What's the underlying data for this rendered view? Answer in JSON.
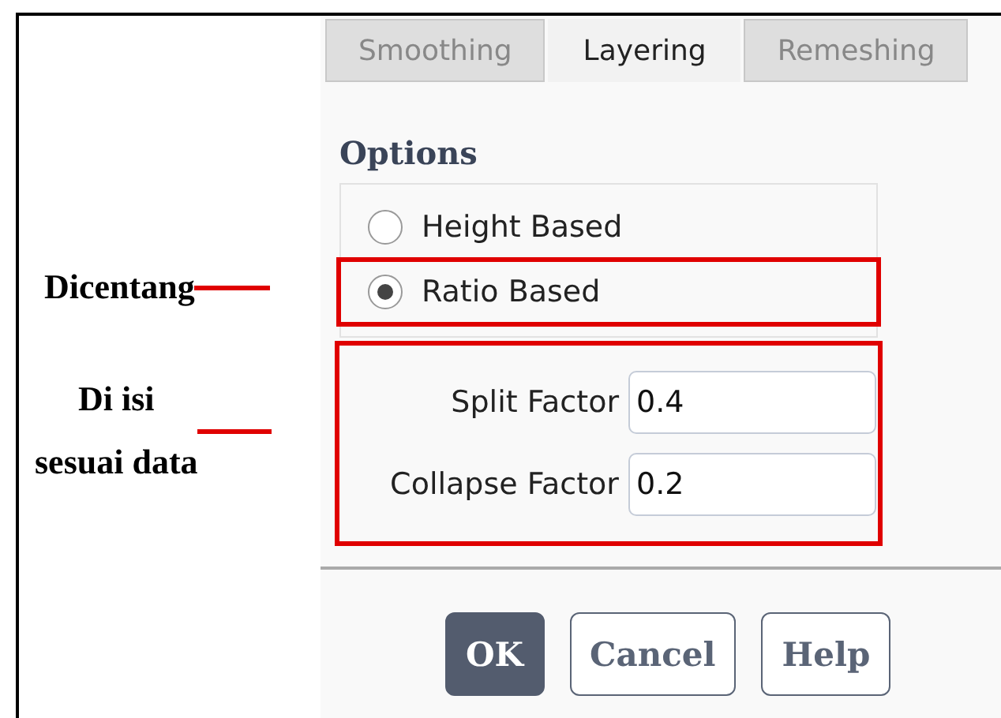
{
  "tabs": [
    {
      "label": "Smoothing",
      "selected": false
    },
    {
      "label": "Layering",
      "selected": true
    },
    {
      "label": "Remeshing",
      "selected": false
    }
  ],
  "options": {
    "title": "Options",
    "choices": [
      {
        "label": "Height Based",
        "selected": false
      },
      {
        "label": "Ratio Based",
        "selected": true
      }
    ]
  },
  "fields": [
    {
      "label": "Split Factor",
      "value": "0.4"
    },
    {
      "label": "Collapse Factor",
      "value": "0.2"
    }
  ],
  "buttons": [
    {
      "label": "OK",
      "kind": "primary"
    },
    {
      "label": "Cancel",
      "kind": "secondary"
    },
    {
      "label": "Help",
      "kind": "secondary"
    }
  ],
  "annotations": [
    {
      "kind": "radio",
      "lines": [
        "Dicentang"
      ]
    },
    {
      "kind": "fields",
      "lines": [
        "Di isi",
        "sesuai data"
      ]
    }
  ]
}
